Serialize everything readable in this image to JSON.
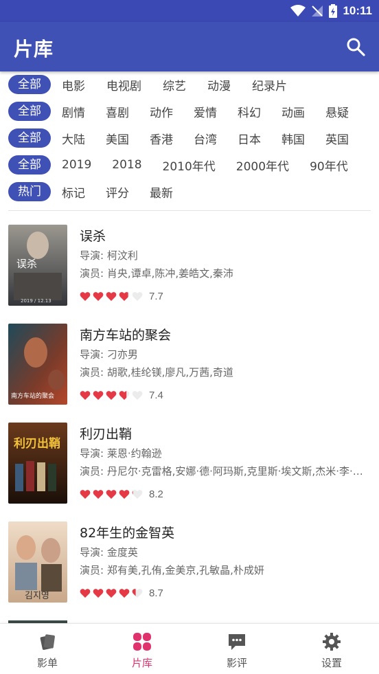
{
  "status": {
    "time": "10:11"
  },
  "app": {
    "title": "片库"
  },
  "filters": [
    {
      "active": "全部",
      "options": [
        "电影",
        "电视剧",
        "综艺",
        "动漫",
        "纪录片"
      ]
    },
    {
      "active": "全部",
      "options": [
        "剧情",
        "喜剧",
        "动作",
        "爱情",
        "科幻",
        "动画",
        "悬疑"
      ]
    },
    {
      "active": "全部",
      "options": [
        "大陆",
        "美国",
        "香港",
        "台湾",
        "日本",
        "韩国",
        "英国"
      ]
    },
    {
      "active": "全部",
      "options": [
        "2019",
        "2018",
        "2010年代",
        "2000年代",
        "90年代"
      ]
    },
    {
      "active": "热门",
      "options": [
        "标记",
        "评分",
        "最新"
      ]
    }
  ],
  "movies": [
    {
      "title": "误杀",
      "director": "导演: 柯汶利",
      "cast": "演员: 肖央,谭卓,陈冲,姜皓文,秦沛",
      "rating": 3.85,
      "score": "7.7",
      "poster_colors": [
        "#8c8a84",
        "#3a3b3f"
      ],
      "poster_text": "误杀",
      "poster_sub": "2019 / 12.13"
    },
    {
      "title": "南方车站的聚会",
      "director": "导演: 刁亦男",
      "cast": "演员: 胡歌,桂纶镁,廖凡,万茜,奇道",
      "rating": 3.7,
      "score": "7.4",
      "poster_colors": [
        "#1f4a5a",
        "#b4472b"
      ],
      "poster_text": "南方车站的聚会",
      "poster_sub": ""
    },
    {
      "title": "利刃出鞘",
      "director": "导演: 莱恩·约翰逊",
      "cast": "演员: 丹尼尔·克雷格,安娜·德·阿玛斯,克里斯·埃文斯,杰米·李·柯蒂斯",
      "rating": 4.1,
      "score": "8.2",
      "poster_colors": [
        "#5a2b14",
        "#1b0f09"
      ],
      "poster_text": "利刃出鞘",
      "poster_sub": ""
    },
    {
      "title": "82年生的金智英",
      "director": "导演: 金度英",
      "cast": "演员: 郑有美,孔侑,金美京,孔敏晶,朴成妍",
      "rating": 4.35,
      "score": "8.7",
      "poster_colors": [
        "#e9d2bc",
        "#c9a88a"
      ],
      "poster_text": "김지영",
      "poster_sub": ""
    }
  ],
  "nav": [
    {
      "label": "影单",
      "icon": "cards-icon"
    },
    {
      "label": "片库",
      "icon": "grid-icon"
    },
    {
      "label": "影评",
      "icon": "chat-icon"
    },
    {
      "label": "设置",
      "icon": "gear-icon"
    }
  ],
  "colors": {
    "primary": "#3f51b5",
    "accent": "#e0336d",
    "heart": "#e53945"
  }
}
